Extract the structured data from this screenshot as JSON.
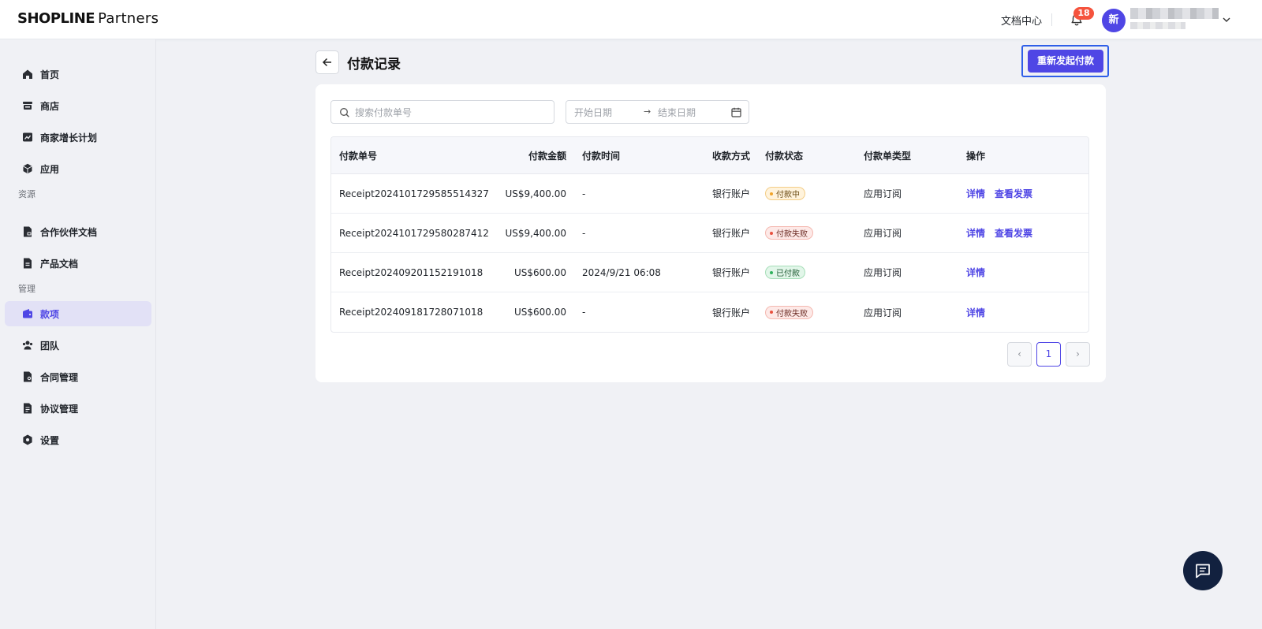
{
  "header": {
    "logo_bold": "SHOPLINE",
    "logo_light": "Partners",
    "docs_label": "文档中心",
    "notification_count": "18",
    "avatar_initial": "新"
  },
  "sidebar": {
    "items_top": [
      {
        "label": "首页",
        "icon": "home-icon"
      },
      {
        "label": "商店",
        "icon": "store-icon"
      },
      {
        "label": "商家增长计划",
        "icon": "chart-icon"
      },
      {
        "label": "应用",
        "icon": "cube-icon"
      }
    ],
    "section_resources": "资源",
    "items_resources": [
      {
        "label": "合作伙伴文档",
        "icon": "doc-lock-icon"
      },
      {
        "label": "产品文档",
        "icon": "document-icon"
      }
    ],
    "section_manage": "管理",
    "items_manage": [
      {
        "label": "款项",
        "icon": "wallet-icon",
        "active": true
      },
      {
        "label": "团队",
        "icon": "team-icon"
      },
      {
        "label": "合同管理",
        "icon": "contract-icon"
      },
      {
        "label": "协议管理",
        "icon": "agreement-icon"
      },
      {
        "label": "设置",
        "icon": "settings-icon"
      }
    ]
  },
  "page": {
    "title": "付款记录",
    "retry_button": "重新发起付款"
  },
  "filters": {
    "search_placeholder": "搜索付款单号",
    "start_placeholder": "开始日期",
    "end_placeholder": "结束日期",
    "range_arrow": "→"
  },
  "table": {
    "columns": [
      "付款单号",
      "付款金额",
      "付款时间",
      "收款方式",
      "付款状态",
      "付款单类型",
      "操作"
    ],
    "rows": [
      {
        "id": "Receipt2024101729585514327",
        "amount": "US$9,400.00",
        "time": "-",
        "method": "银行账户",
        "status": "付款中",
        "status_type": "warn",
        "type": "应用订阅",
        "actions": [
          "详情",
          "查看发票"
        ]
      },
      {
        "id": "Receipt2024101729580287412",
        "amount": "US$9,400.00",
        "time": "-",
        "method": "银行账户",
        "status": "付款失败",
        "status_type": "fail",
        "type": "应用订阅",
        "actions": [
          "详情",
          "查看发票"
        ]
      },
      {
        "id": "Receipt202409201152191018",
        "amount": "US$600.00",
        "time": "2024/9/21 06:08",
        "method": "银行账户",
        "status": "已付款",
        "status_type": "ok",
        "type": "应用订阅",
        "actions": [
          "详情"
        ]
      },
      {
        "id": "Receipt202409181728071018",
        "amount": "US$600.00",
        "time": "-",
        "method": "银行账户",
        "status": "付款失败",
        "status_type": "fail",
        "type": "应用订阅",
        "actions": [
          "详情"
        ]
      }
    ]
  },
  "pagination": {
    "prev": "‹",
    "current": "1",
    "next": "›"
  },
  "colors": {
    "accent": "#4f46e5",
    "focus_ring": "#2f5fe8",
    "badge": "#f5533d",
    "chat_fab": "#12213f"
  }
}
